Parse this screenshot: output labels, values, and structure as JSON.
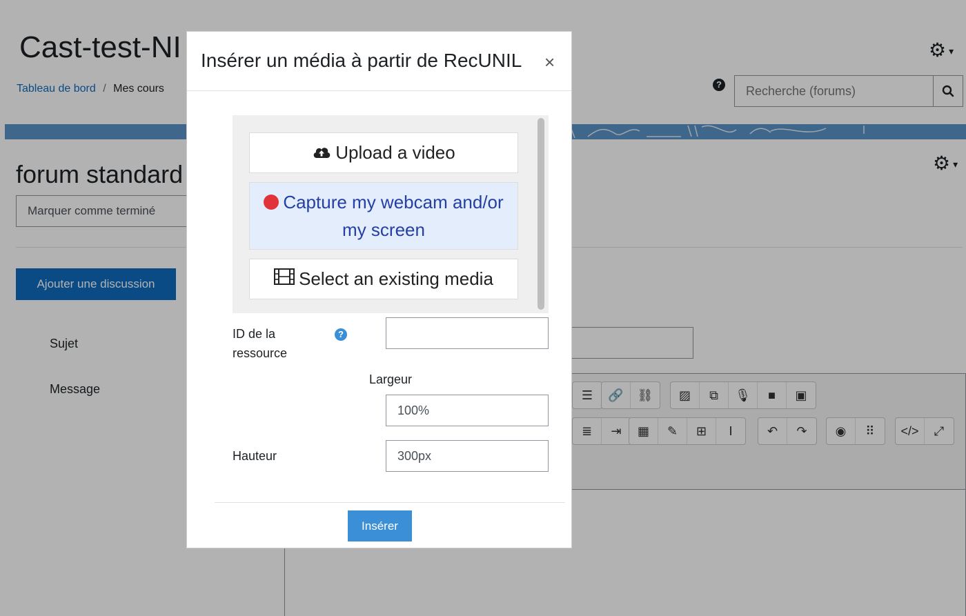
{
  "page": {
    "course_title": "Cast-test-NI",
    "breadcrumb": {
      "home": "Tableau de bord",
      "separator": "/",
      "current": "Mes cours"
    },
    "search": {
      "placeholder": "Recherche (forums)"
    },
    "forum_title": "forum standard",
    "mark_done": "Marquer comme terminé",
    "add_discussion": "Ajouter une discussion",
    "labels": {
      "subject": "Sujet",
      "message": "Message"
    }
  },
  "modal": {
    "title": "Insérer un média à partir de RecUNIL",
    "close": "×",
    "frame": {
      "upload": "Upload a video",
      "capture": "Capture my webcam and/or my screen",
      "select": "Select an existing media"
    },
    "fields": {
      "resource_id_label": "ID de la ressource",
      "resource_id_value": "",
      "width_label": "Largeur",
      "width_value": "100%",
      "height_label": "Hauteur",
      "height_value": "300px"
    },
    "insert": "Insérer"
  },
  "colors": {
    "primary": "#0f6cbf",
    "insert_button": "#3a8fd6",
    "capture_bg": "#e3edfb",
    "capture_text": "#253fa3",
    "record_dot": "#e0343a",
    "banner": "#5b93c7"
  }
}
